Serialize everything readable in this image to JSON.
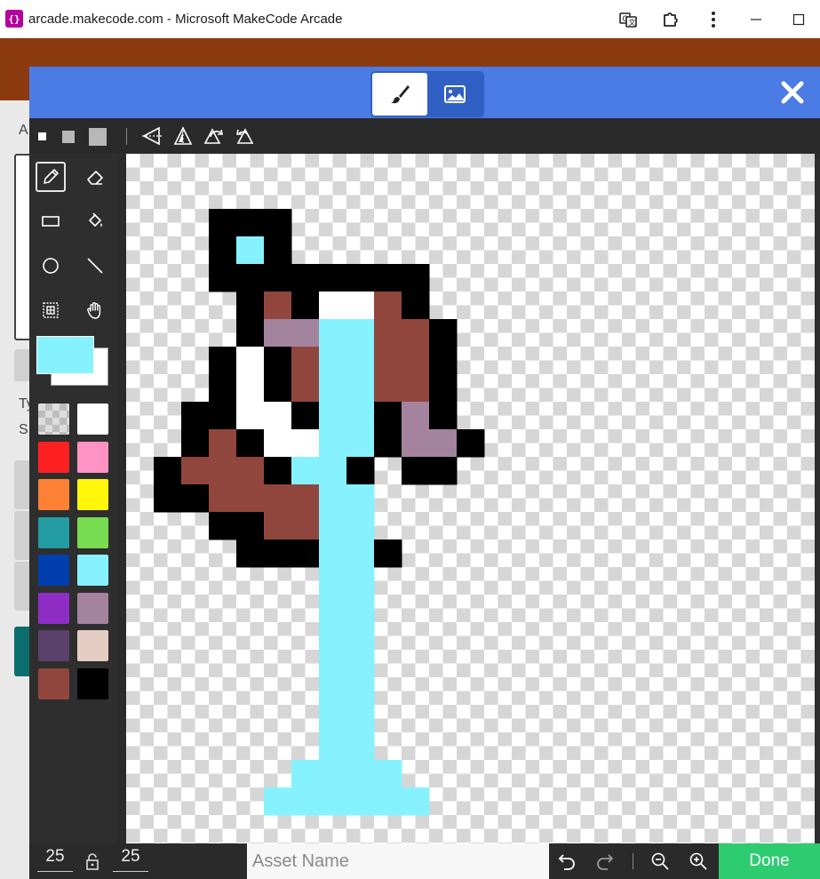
{
  "window": {
    "app_icon_glyph": "{}",
    "title": "arcade.makecode.com - Microsoft MakeCode Arcade"
  },
  "background_page": {
    "partial_letters": [
      "A",
      "Ty",
      "S"
    ]
  },
  "header": {
    "modes": [
      {
        "name": "paint-brush-icon",
        "active": true
      },
      {
        "name": "image-gallery-icon",
        "active": false
      }
    ]
  },
  "toolbar": {
    "brush_sizes": [
      "small",
      "medium",
      "large"
    ],
    "symmetry_tools": [
      "flip-vertical-icon",
      "flip-horizontal-icon",
      "rotate-cw-icon",
      "rotate-ccw-icon"
    ]
  },
  "tools": [
    {
      "name": "pencil-tool",
      "selected": true
    },
    {
      "name": "eraser-tool",
      "selected": false
    },
    {
      "name": "rectangle-tool",
      "selected": false
    },
    {
      "name": "fill-tool",
      "selected": false
    },
    {
      "name": "circle-tool",
      "selected": false
    },
    {
      "name": "line-tool",
      "selected": false
    },
    {
      "name": "marquee-tool",
      "selected": false
    },
    {
      "name": "pan-tool",
      "selected": false
    }
  ],
  "colors": {
    "foreground": "#87f2ff",
    "background": "#ffffff",
    "palette": [
      "transparent",
      "#ffffff",
      "#ff2121",
      "#ff93c4",
      "#ff8135",
      "#fff609",
      "#249ca3",
      "#78dc52",
      "#003fad",
      "#87f2ff",
      "#8e2ec4",
      "#a4839f",
      "#5c406c",
      "#e5cdc4",
      "#91463d",
      "#000000"
    ]
  },
  "canvas": {
    "grid_columns": 25,
    "pixel_rows": [
      "",
      "",
      "   ...",
      "   .9.",
      "   ........",
      "    .a.11a.",
      "    .bb99ia.",
      "   .1.a99ia.",
      "   .1.a99ia.",
      "  ..11.99.b.",
      "  .a.1199.bb.",
      " .aaa.99. ..",
      " ..aaaa99",
      "   ..aa99",
      "    ...99.",
      "       99",
      "       99",
      "       99",
      "       99",
      "       99",
      "       99",
      "       99",
      "      9999",
      "     999999"
    ],
    "legend": {
      ".": "#000000",
      "1": "#ffffff",
      "9": "#87f2ff",
      "a": "#91463d",
      "b": "#a4839f",
      "i": "#91463d"
    }
  },
  "bottom": {
    "width": "25",
    "height": "25",
    "asset_name_placeholder": "Asset Name",
    "asset_name_value": "",
    "done_label": "Done"
  }
}
